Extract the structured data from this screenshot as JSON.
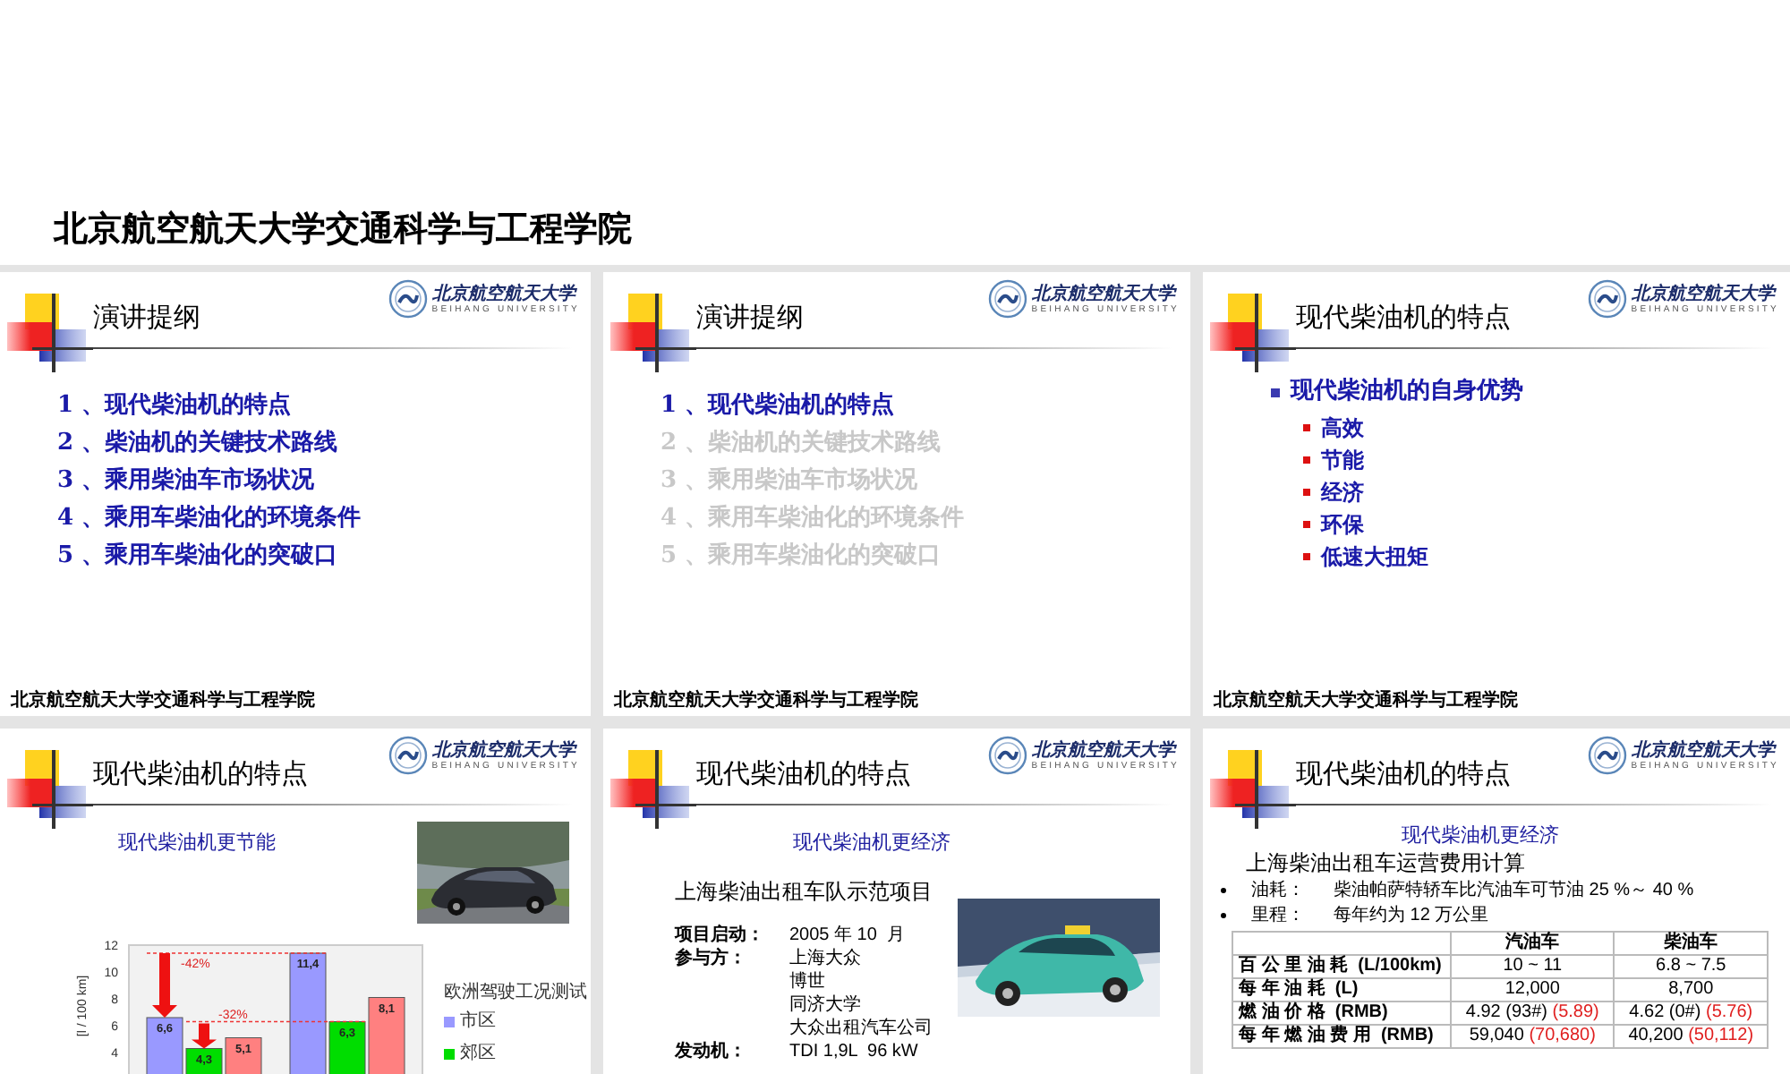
{
  "header": {
    "title": "北京航空航天大学交通科学与工程学院"
  },
  "slides": [
    {
      "kind": "outline",
      "title": "演讲提纲",
      "logo": {
        "name": "北京航空航天大学",
        "subtitle": "BEIHANG UNIVERSITY"
      },
      "footer": "北京航空航天大学交通科学与工程学院",
      "items": [
        {
          "text": "1 、现代柴油机的特点",
          "highlighted": true
        },
        {
          "text": "2 、柴油机的关键技术路线",
          "highlighted": true
        },
        {
          "text": "3 、乘用柴油车市场状况",
          "highlighted": true
        },
        {
          "text": "4 、乘用车柴油化的环境条件",
          "highlighted": true
        },
        {
          "text": "5 、乘用车柴油化的突破口",
          "highlighted": true
        }
      ]
    },
    {
      "kind": "outline",
      "title": "演讲提纲",
      "logo": {
        "name": "北京航空航天大学",
        "subtitle": "BEIHANG UNIVERSITY"
      },
      "footer": "北京航空航天大学交通科学与工程学院",
      "items": [
        {
          "text": "1 、现代柴油机的特点",
          "highlighted": true
        },
        {
          "text": "2 、柴油机的关键技术路线",
          "highlighted": false
        },
        {
          "text": "3 、乘用柴油车市场状况",
          "highlighted": false
        },
        {
          "text": "4 、乘用车柴油化的环境条件",
          "highlighted": false
        },
        {
          "text": "5 、乘用车柴油化的突破口",
          "highlighted": false
        }
      ]
    },
    {
      "kind": "bullets",
      "title": "现代柴油机的特点",
      "logo": {
        "name": "北京航空航天大学",
        "subtitle": "BEIHANG UNIVERSITY"
      },
      "footer": "北京航空航天大学交通科学与工程学院",
      "items": [
        {
          "text": "现代柴油机的自身优势",
          "children": [
            {
              "text": "高效"
            },
            {
              "text": "节能"
            },
            {
              "text": "经济"
            },
            {
              "text": "环保"
            },
            {
              "text": "低速大扭矩"
            }
          ]
        }
      ]
    },
    {
      "kind": "chart",
      "title": "现代柴油机的特点",
      "logo": {
        "name": "北京航空航天大学",
        "subtitle": "BEIHANG UNIVERSITY"
      },
      "subtitle": "现代柴油机更节能",
      "photo": {
        "kind": "picture"
      },
      "legend_title": "欧洲驾驶工况测试",
      "chart_data": {
        "type": "bar",
        "ylabel": "[l / 100 km]",
        "ylim": [
          0,
          12
        ],
        "yticks": [
          4,
          6,
          8,
          10,
          12
        ],
        "series": [
          {
            "name": "市区",
            "color": "#9999ff",
            "values": [
              6.6,
              11.4
            ],
            "value_labels": [
              "6,6",
              "11,4"
            ]
          },
          {
            "name": "郊区",
            "color": "#00dd00",
            "values": [
              4.3,
              6.3
            ],
            "value_labels": [
              "4,3",
              "6,3"
            ]
          },
          {
            "color": "#ff8080",
            "values": [
              5.1,
              8.1
            ],
            "value_labels": [
              "5,1",
              "8,1"
            ]
          }
        ],
        "annotations": [
          {
            "text": "-42%"
          },
          {
            "text": "-32%"
          }
        ]
      }
    },
    {
      "kind": "project",
      "title": "现代柴油机的特点",
      "logo": {
        "name": "北京航空航天大学",
        "subtitle": "BEIHANG UNIVERSITY"
      },
      "subtitle": "现代柴油机更经济",
      "heading": "上海柴油出租车队示范项目",
      "photo": {
        "kind": "picture"
      },
      "facts": [
        {
          "label": "项目启动：",
          "values": [
            "2005 年 10  月"
          ]
        },
        {
          "label": "参与方：",
          "values": [
            "上海大众",
            "博世",
            "同济大学",
            "大众出租汽车公司"
          ]
        },
        {
          "label": "发动机：",
          "values": [
            "TDI 1,9L  96 kW"
          ]
        }
      ]
    },
    {
      "kind": "table",
      "title": "现代柴油机的特点",
      "logo": {
        "name": "北京航空航天大学",
        "subtitle": "BEIHANG UNIVERSITY"
      },
      "subtitle": "现代柴油机更经济",
      "heading": "上海柴油出租车运营费用计算",
      "bullets": [
        {
          "label": "油耗：",
          "text": "柴油帕萨特轿车比汽油车可节油 25 %～ 40 %"
        },
        {
          "label": "里程：",
          "text": "每年约为 12 万公里"
        }
      ],
      "table": {
        "columns": [
          "汽油车",
          "柴油车"
        ],
        "rows": [
          {
            "label": "百 公 里 油 耗  (L/100km)",
            "cells": [
              {
                "text": "10 ~ 11"
              },
              {
                "text": "6.8 ~ 7.5"
              }
            ]
          },
          {
            "label": "每 年 油 耗  (L)",
            "cells": [
              {
                "text": "12,000"
              },
              {
                "text": "8,700"
              }
            ]
          },
          {
            "label": "燃 油 价 格  (RMB)",
            "cells": [
              {
                "text": "4.92 (93#)",
                "note": "(5.89)"
              },
              {
                "text": "4.62 (0#)",
                "note": "(5.76)"
              }
            ]
          },
          {
            "label": "每 年 燃 油 费 用  (RMB)",
            "cells": [
              {
                "text": "59,040",
                "note": "(70,680)"
              },
              {
                "text": "40,200",
                "note": "(50,112)"
              }
            ]
          }
        ]
      }
    }
  ]
}
